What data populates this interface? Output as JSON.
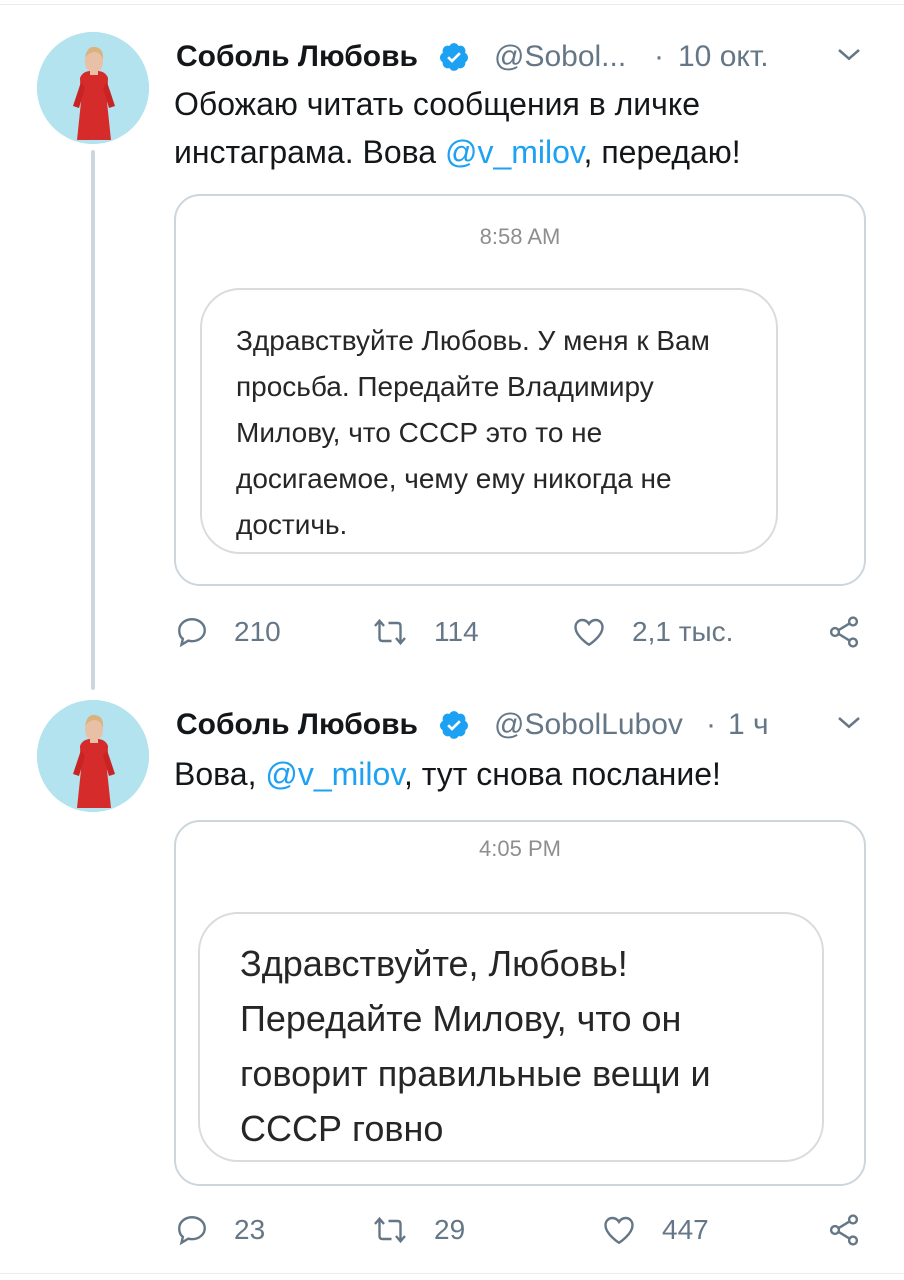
{
  "tweets": [
    {
      "author_name": "Соболь Любовь",
      "handle": "@Sobol...",
      "separator": "·",
      "time": "10 окт.",
      "text_before": "Обожаю читать сообщения в личке инстаграма. Вова ",
      "mention": "@v_milov",
      "text_after": ", передаю!",
      "dm_time": "8:58 AM",
      "dm_message": "Здравствуйте Любовь. У меня к Вам просьба. Передайте Владимиру Милову, что СССР это то не досигаемое, чему ему никогда не достичь.",
      "replies": "210",
      "retweets": "114",
      "likes": "2,1 тыс."
    },
    {
      "author_name": "Соболь Любовь",
      "handle": "@SobolLubov",
      "separator": "·",
      "time": "1 ч",
      "text_before": "Вова, ",
      "mention": "@v_milov",
      "text_after": ", тут снова послание!",
      "dm_time": "4:05 PM",
      "dm_message": "Здравствуйте, Любовь! Передайте Милову, что он говорит правильные вещи и СССР говно",
      "replies": "23",
      "retweets": "29",
      "likes": "447"
    }
  ],
  "icons": {
    "reply": "reply-icon",
    "retweet": "retweet-icon",
    "like": "heart-icon",
    "share": "share-icon",
    "verified": "verified-badge-icon",
    "caret": "chevron-down-icon"
  },
  "colors": {
    "accent": "#1da1f2",
    "secondary_text": "#657786",
    "border": "#ccd6dd"
  }
}
